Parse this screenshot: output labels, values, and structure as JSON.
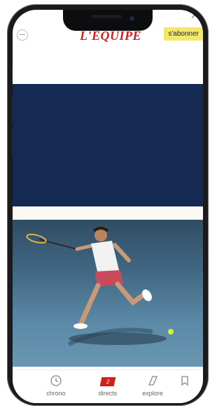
{
  "header": {
    "logo_text": "L'EQUIPE",
    "subscribe_label": "s'abonner",
    "status_right": "↗"
  },
  "colors": {
    "brand_red": "#d1201b",
    "ad_navy": "#142a52",
    "subscribe_yellow": "#f3e86a"
  },
  "bottom_nav": {
    "items": [
      {
        "label": "chrono",
        "icon": "clock-icon"
      },
      {
        "label": "directs",
        "icon": "live-badge-icon",
        "badge": "2"
      },
      {
        "label": "explore",
        "icon": "explore-icon"
      },
      {
        "label": "",
        "icon": "bookmark-icon"
      }
    ]
  }
}
